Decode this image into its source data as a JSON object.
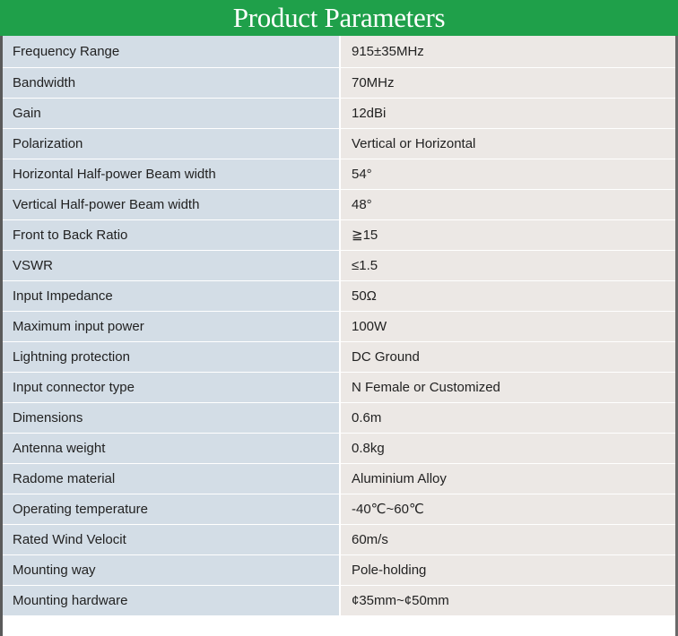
{
  "header": {
    "title": "Product Parameters"
  },
  "parameters": [
    {
      "name": "Frequency Range",
      "value": "915±35MHz"
    },
    {
      "name": "Bandwidth",
      "value": "70MHz"
    },
    {
      "name": "Gain",
      "value": "12dBi"
    },
    {
      "name": "Polarization",
      "value": "Vertical or Horizontal"
    },
    {
      "name": "Horizontal Half-power Beam width",
      "value": "54°"
    },
    {
      "name": "Vertical Half-power Beam width",
      "value": "48°"
    },
    {
      "name": "Front to Back Ratio",
      "value": "≧15"
    },
    {
      "name": "VSWR",
      "value": "≤1.5"
    },
    {
      "name": "Input Impedance",
      "value": "50Ω"
    },
    {
      "name": "Maximum input power",
      "value": "100W"
    },
    {
      "name": "Lightning protection",
      "value": "DC Ground"
    },
    {
      "name": "Input connector type",
      "value": "N Female or Customized"
    },
    {
      "name": "Dimensions",
      "value": "0.6m"
    },
    {
      "name": "Antenna weight",
      "value": "0.8kg"
    },
    {
      "name": "Radome material",
      "value": "Aluminium Alloy"
    },
    {
      "name": "Operating temperature",
      "value": "-40℃~60℃"
    },
    {
      "name": "Rated Wind Velocit",
      "value": "60m/s"
    },
    {
      "name": "Mounting way",
      "value": "Pole-holding"
    },
    {
      "name": "Mounting hardware",
      "value": "¢35mm~¢50mm"
    }
  ],
  "colors": {
    "header_bg": "#1fa04a",
    "name_cell_bg": "#d3dde6",
    "value_cell_bg": "#ece8e5"
  }
}
